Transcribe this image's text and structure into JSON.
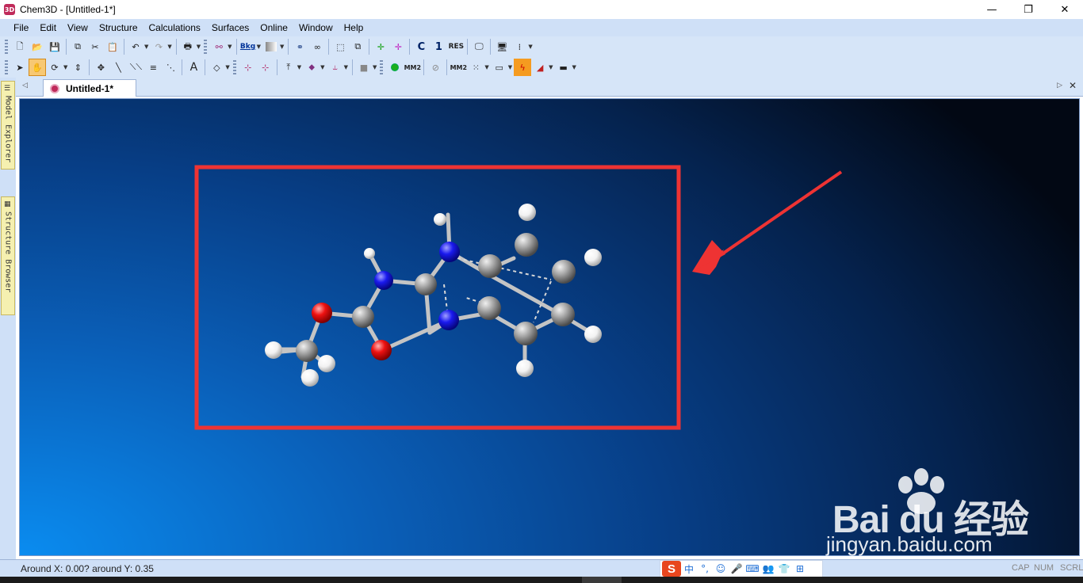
{
  "window": {
    "app_icon_text": "3D",
    "title": "Chem3D - [Untitled-1*]",
    "minimize_icon": "minimize-icon",
    "maximize_icon": "restore-icon",
    "close_icon": "close-icon"
  },
  "menu": [
    "File",
    "Edit",
    "View",
    "Structure",
    "Calculations",
    "Surfaces",
    "Online",
    "Window",
    "Help"
  ],
  "toolbar1": {
    "bkg_label": "Bkg",
    "tools": [
      "new-icon",
      "open-icon",
      "save-icon",
      "copy-icon",
      "cut-icon",
      "paste-icon",
      "undo-icon",
      "redo-icon",
      "print-icon"
    ],
    "c_label": "C",
    "one_label": "1",
    "res_label": "RES"
  },
  "toolbar2": {
    "text_tool": "A",
    "mm2_label": "MM2",
    "mm2_run_label": "MM2"
  },
  "sidebar": {
    "model_explorer": "Model Explorer",
    "structure_browser": "Structure Browser"
  },
  "document_tab": {
    "label": "Untitled-1*"
  },
  "molecule": {
    "colors": {
      "carbon": "#a8a8a8",
      "hydrogen": "#f2f2f2",
      "nitrogen": "#1a1aee",
      "oxygen": "#ee1111",
      "bond": "#c4c4c4",
      "annotation": "#ee3333"
    }
  },
  "watermark": {
    "brand": "Bai du 经验",
    "url": "jingyan.baidu.com"
  },
  "status": {
    "text": "Around X: 0.00? around Y: 0.35",
    "cap": "CAP",
    "num": "NUM",
    "scrl": "SCRL"
  },
  "ime": {
    "logo": "S",
    "items": [
      "中",
      "°,",
      "☺",
      "🎤",
      "⌨",
      "👥",
      "👕",
      "⊞"
    ]
  }
}
